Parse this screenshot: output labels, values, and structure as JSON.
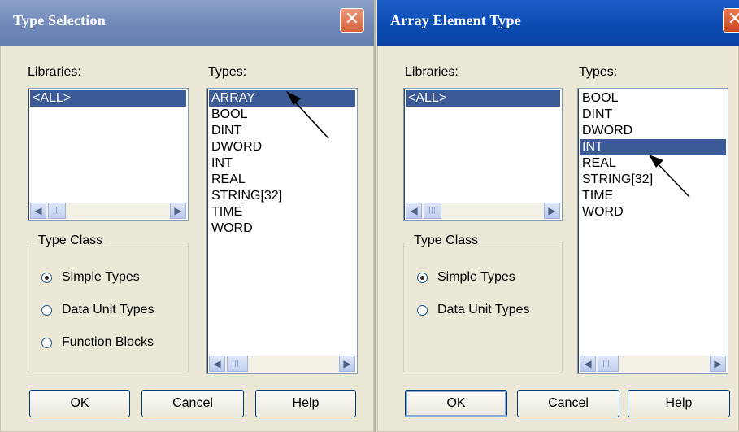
{
  "dialog1": {
    "title": "Type Selection",
    "close_glyph": "✕",
    "libraries_label": "Libraries:",
    "libraries": [
      "<ALL>"
    ],
    "libraries_selected": 0,
    "types_label": "Types:",
    "types": [
      "ARRAY",
      "BOOL",
      "DINT",
      "DWORD",
      "INT",
      "REAL",
      "STRING[32]",
      "TIME",
      "WORD"
    ],
    "types_selected": 0,
    "type_class_label": "Type Class",
    "type_class_options": [
      "Simple Types",
      "Data Unit Types",
      "Function Blocks"
    ],
    "type_class_selected": 0,
    "buttons": {
      "ok": "OK",
      "cancel": "Cancel",
      "help": "Help"
    }
  },
  "dialog2": {
    "title": "Array Element Type",
    "close_glyph": "✕",
    "libraries_label": "Libraries:",
    "libraries": [
      "<ALL>"
    ],
    "libraries_selected": 0,
    "types_label": "Types:",
    "types": [
      "BOOL",
      "DINT",
      "DWORD",
      "INT",
      "REAL",
      "STRING[32]",
      "TIME",
      "WORD"
    ],
    "types_selected": 3,
    "type_class_label": "Type Class",
    "type_class_options": [
      "Simple Types",
      "Data Unit Types"
    ],
    "type_class_selected": 0,
    "buttons": {
      "ok": "OK",
      "cancel": "Cancel",
      "help": "Help"
    }
  },
  "icons": {
    "scroll_left": "◀",
    "scroll_right": "▶"
  },
  "colors": {
    "selection": "#3c5a96",
    "active_title": "#0a4ab0",
    "inactive_title": "#7088b8",
    "close_button": "#d8613d",
    "dialog_bg": "#ebe8d8"
  }
}
